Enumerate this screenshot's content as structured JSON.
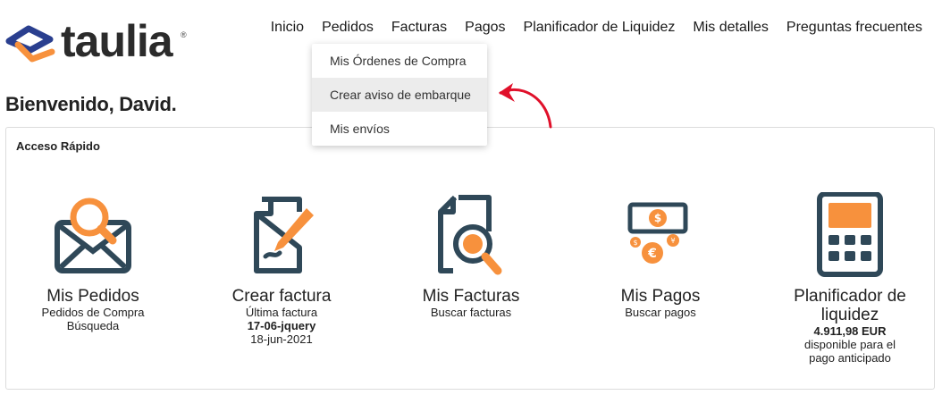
{
  "brand": {
    "name": "taulia",
    "reg": "®"
  },
  "nav": [
    {
      "label": "Inicio"
    },
    {
      "label": "Pedidos"
    },
    {
      "label": "Facturas"
    },
    {
      "label": "Pagos"
    },
    {
      "label": "Planificador de Liquidez"
    },
    {
      "label": "Mis detalles"
    },
    {
      "label": "Preguntas frecuentes"
    }
  ],
  "dropdown": {
    "items": [
      {
        "label": "Mis Órdenes de Compra"
      },
      {
        "label": "Crear aviso de embarque"
      },
      {
        "label": "Mis envíos"
      }
    ]
  },
  "welcome": "Bienvenido, David.",
  "quick_access": {
    "title": "Acceso Rápido",
    "tiles": [
      {
        "title": "Mis Pedidos",
        "lines": [
          "Pedidos de Compra",
          "Búsqueda"
        ],
        "icon": "envelope-search-icon"
      },
      {
        "title": "Crear factura",
        "lines": [
          "Última factura",
          "17-06-jquery",
          "18-jun-2021"
        ],
        "icon": "document-pencil-icon"
      },
      {
        "title": "Mis Facturas",
        "lines": [
          "Buscar facturas"
        ],
        "icon": "document-search-icon"
      },
      {
        "title": "Mis Pagos",
        "lines": [
          "Buscar pagos"
        ],
        "icon": "money-icon"
      },
      {
        "title_lines": [
          "Planificador de",
          "liquidez"
        ],
        "lines": [
          "4.911,98 EUR",
          "disponible para el",
          "pago anticipado"
        ],
        "icon": "calculator-icon"
      }
    ]
  },
  "colors": {
    "orange": "#f7913d",
    "navy": "#2f4858",
    "brand_blue": "#2a3f8f",
    "arrow_red": "#e0102a"
  }
}
